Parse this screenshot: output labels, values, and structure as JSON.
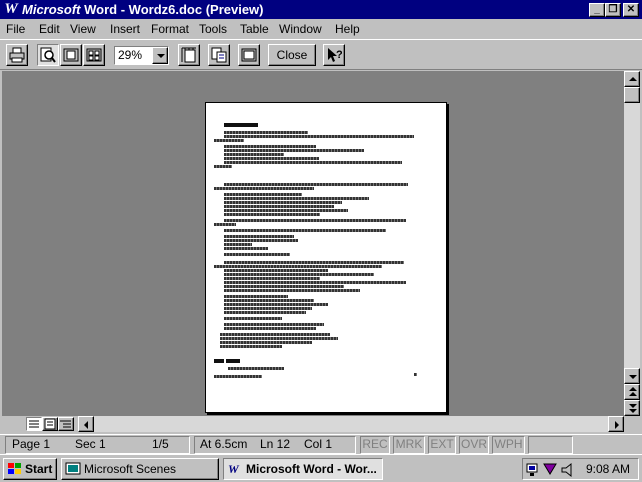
{
  "window": {
    "title_brand": "Microsoft",
    "title_rest": "Word - Wordz6.doc (Preview)",
    "app_icon": "W",
    "buttons": {
      "minimize": "_",
      "restore": "❐",
      "close": "✕"
    }
  },
  "menu": [
    "File",
    "Edit",
    "View",
    "Insert",
    "Format",
    "Tools",
    "Table",
    "Window",
    "Help"
  ],
  "toolbar": {
    "icons": [
      "print-icon",
      "magnifier-icon",
      "one-page-icon",
      "multiple-pages-icon",
      "view-ruler-icon",
      "shrink-to-fit-icon",
      "full-screen-icon",
      "context-help-icon"
    ],
    "zoom_value": "29%",
    "close_label": "Close"
  },
  "status": {
    "page": "Page 1",
    "sec": "Sec 1",
    "pages": "1/5",
    "at": "At 6.5cm",
    "ln": "Ln 12",
    "col": "Col 1",
    "modes": [
      "REC",
      "MRK",
      "EXT",
      "OVR",
      "WPH"
    ]
  },
  "taskbar": {
    "start": "Start",
    "tasks": [
      "Microsoft Scenes",
      "Microsoft Word - Wor..."
    ],
    "active_task": 1,
    "clock": "9:08 AM"
  },
  "colors": {
    "titlebar": "#000080",
    "face": "#c0c0c0",
    "workspace": "#808080"
  }
}
